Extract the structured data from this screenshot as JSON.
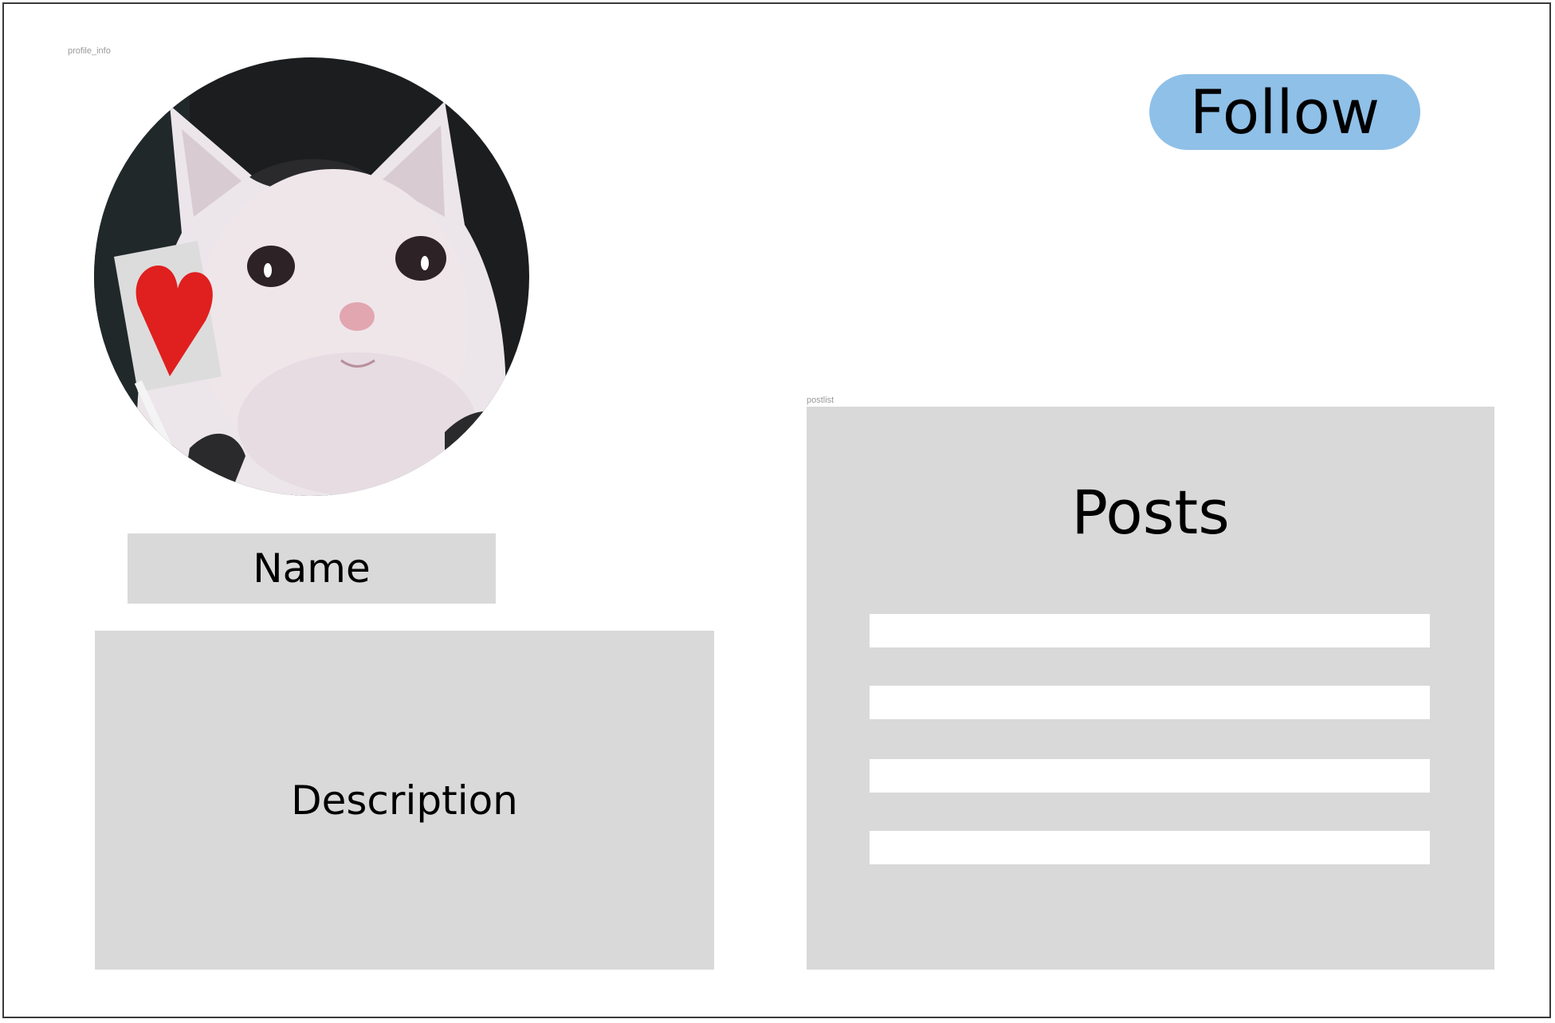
{
  "profile_info": {
    "frame_label": "profile_info",
    "avatar": {
      "alt": "profile picture"
    },
    "name_label": "Name",
    "description_label": "Description"
  },
  "actions": {
    "follow_label": "Follow"
  },
  "postlist": {
    "frame_label": "postlist",
    "title": "Posts",
    "items": [
      "",
      "",
      "",
      ""
    ]
  },
  "colors": {
    "follow_button": "#8fc0e8",
    "placeholder_gray": "#d9d9d9",
    "post_item": "#ffffff"
  }
}
